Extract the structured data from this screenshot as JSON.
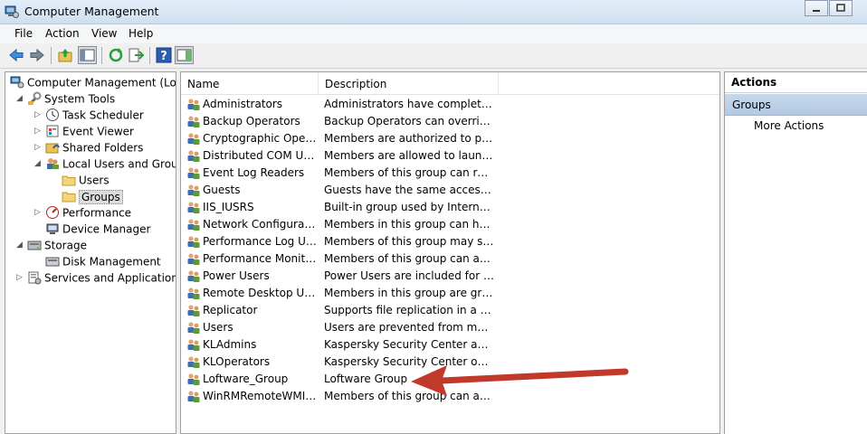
{
  "window": {
    "title": "Computer Management"
  },
  "menu": [
    "File",
    "Action",
    "View",
    "Help"
  ],
  "tree": [
    {
      "label": "Computer Management (Local",
      "icon": "computer-management-icon",
      "expander": "",
      "level": 0
    },
    {
      "label": "System Tools",
      "icon": "system-tools-icon",
      "expander": "◢",
      "level": 1
    },
    {
      "label": "Task Scheduler",
      "icon": "task-scheduler-icon",
      "expander": "▷",
      "level": 2
    },
    {
      "label": "Event Viewer",
      "icon": "event-viewer-icon",
      "expander": "▷",
      "level": 2
    },
    {
      "label": "Shared Folders",
      "icon": "shared-folders-icon",
      "expander": "▷",
      "level": 2
    },
    {
      "label": "Local Users and Groups",
      "icon": "local-users-icon",
      "expander": "◢",
      "level": 2
    },
    {
      "label": "Users",
      "icon": "folder-icon",
      "expander": "",
      "level": 3
    },
    {
      "label": "Groups",
      "icon": "folder-icon",
      "expander": "",
      "level": 3
    },
    {
      "label": "Performance",
      "icon": "performance-icon",
      "expander": "▷",
      "level": 2
    },
    {
      "label": "Device Manager",
      "icon": "device-manager-icon",
      "expander": "",
      "level": 2
    },
    {
      "label": "Storage",
      "icon": "storage-icon",
      "expander": "◢",
      "level": 1
    },
    {
      "label": "Disk Management",
      "icon": "disk-management-icon",
      "expander": "",
      "level": 2
    },
    {
      "label": "Services and Applications",
      "icon": "services-icon",
      "expander": "▷",
      "level": 1
    }
  ],
  "list": {
    "columns": [
      "Name",
      "Description"
    ],
    "rows": [
      {
        "name": "Administrators",
        "desc": "Administrators have complete an..."
      },
      {
        "name": "Backup Operators",
        "desc": "Backup Operators can override se..."
      },
      {
        "name": "Cryptographic Operat...",
        "desc": "Members are authorized to perfor..."
      },
      {
        "name": "Distributed COM Users",
        "desc": "Members are allowed to launch, a..."
      },
      {
        "name": "Event Log Readers",
        "desc": "Members of this group can read e..."
      },
      {
        "name": "Guests",
        "desc": "Guests have the same access as m..."
      },
      {
        "name": "IIS_IUSRS",
        "desc": "Built-in group used by Internet Inf..."
      },
      {
        "name": "Network Configuratio...",
        "desc": "Members in this group can have s..."
      },
      {
        "name": "Performance Log Users",
        "desc": "Members of this group may sche..."
      },
      {
        "name": "Performance Monitor ...",
        "desc": "Members of this group can acces..."
      },
      {
        "name": "Power Users",
        "desc": "Power Users are included for back..."
      },
      {
        "name": "Remote Desktop Users",
        "desc": "Members in this group are grante..."
      },
      {
        "name": "Replicator",
        "desc": "Supports file replication in a dom..."
      },
      {
        "name": "Users",
        "desc": "Users are prevented from making ..."
      },
      {
        "name": "KLAdmins",
        "desc": "Kaspersky Security Center admini..."
      },
      {
        "name": "KLOperators",
        "desc": "Kaspersky Security Center operators"
      },
      {
        "name": "Loftware_Group",
        "desc": "Loftware Group"
      },
      {
        "name": "WinRMRemoteWMIU...",
        "desc": "Members of this group can acces..."
      }
    ]
  },
  "actions": {
    "header": "Actions",
    "group": "Groups",
    "more": "More Actions"
  },
  "annotation": {
    "arrow_color": "#c0392b"
  }
}
